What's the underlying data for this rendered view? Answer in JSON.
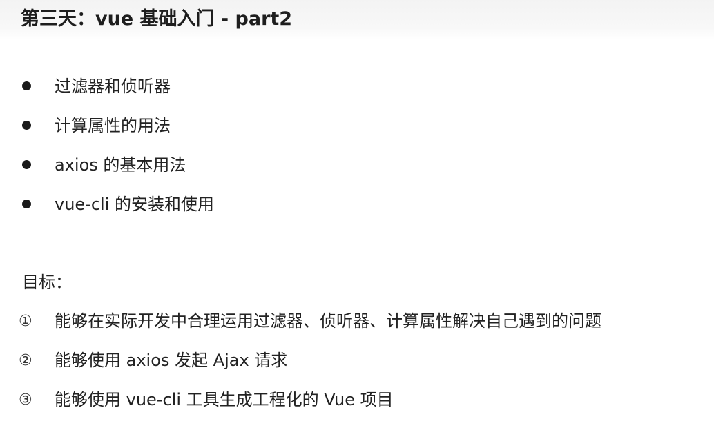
{
  "title": "第三天：vue 基础入门 - part2",
  "topics": [
    "过滤器和侦听器",
    "计算属性的用法",
    "axios 的基本用法",
    "vue-cli 的安装和使用"
  ],
  "goals_heading": "目标：",
  "goals": [
    {
      "marker": "①",
      "text": "能够在实际开发中合理运用过滤器、侦听器、计算属性解决自己遇到的问题"
    },
    {
      "marker": "②",
      "text": "能够使用 axios 发起 Ajax 请求"
    },
    {
      "marker": "③",
      "text": "能够使用 vue-cli 工具生成工程化的 Vue 项目"
    }
  ]
}
